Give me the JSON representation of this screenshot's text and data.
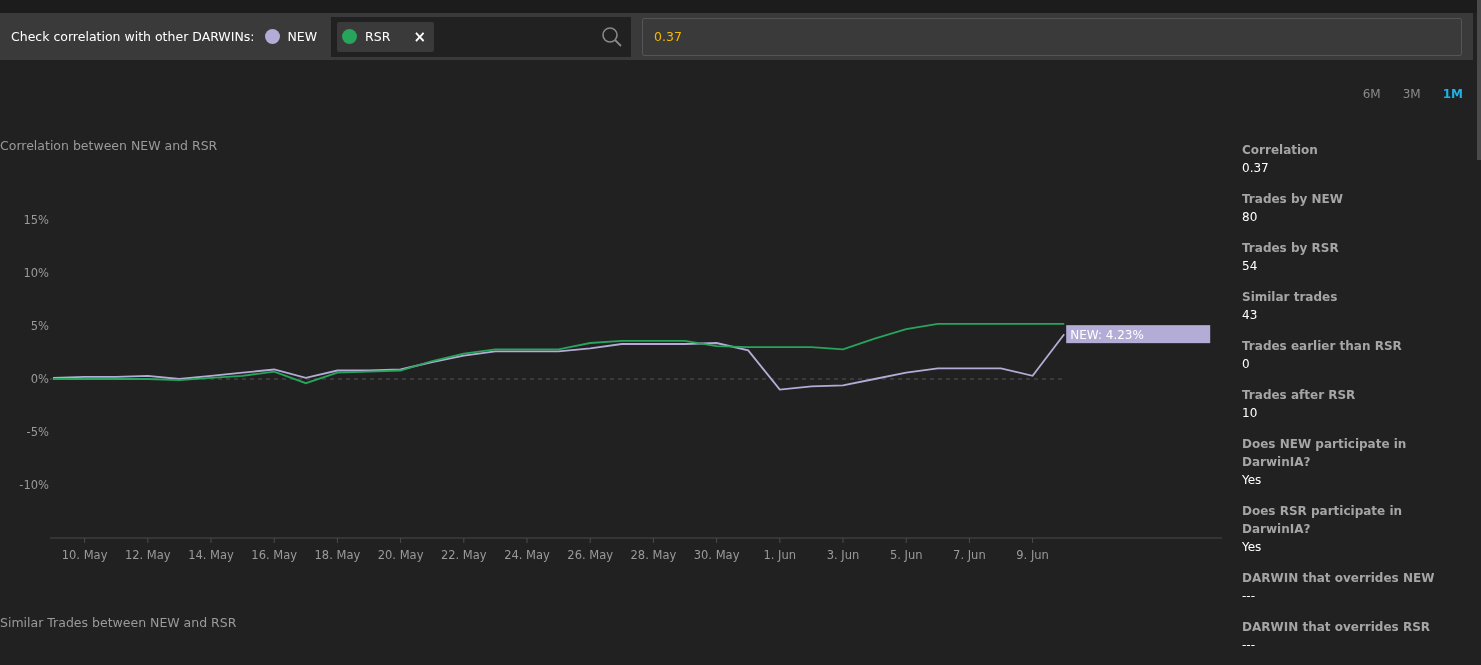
{
  "header": {
    "label": "Check correlation with other DARWINs:",
    "base": {
      "name": "NEW",
      "color": "#b3acd6"
    },
    "chips": [
      {
        "name": "RSR",
        "color": "#27a55a",
        "remove": "×"
      }
    ],
    "result": "0.37"
  },
  "ranges": [
    {
      "label": "6M",
      "selected": false
    },
    {
      "label": "3M",
      "selected": false
    },
    {
      "label": "1M",
      "selected": true
    }
  ],
  "chart": {
    "title": "Correlation between NEW and RSR",
    "chart_data": {
      "type": "line",
      "categories": [
        null,
        "10. May",
        null,
        "12. May",
        null,
        "14. May",
        null,
        "16. May",
        null,
        "18. May",
        null,
        "20. May",
        null,
        "22. May",
        null,
        "24. May",
        null,
        "26. May",
        null,
        "28. May",
        null,
        "30. May",
        null,
        "1. Jun",
        null,
        "3. Jun",
        null,
        "5. Jun",
        null,
        "7. Jun",
        null,
        "9. Jun",
        null
      ],
      "series": [
        {
          "color": "#b3acd6",
          "values": [
            0.1,
            0.2,
            0.2,
            0.3,
            0.0,
            0.3,
            0.6,
            0.9,
            0.1,
            0.8,
            0.8,
            0.9,
            1.6,
            2.2,
            2.6,
            2.6,
            2.6,
            2.9,
            3.3,
            3.3,
            3.3,
            3.4,
            2.7,
            -1.0,
            -0.7,
            -0.6,
            0.0,
            0.6,
            1.0,
            1.0,
            1.0,
            0.3,
            4.23
          ]
        },
        {
          "color": "#27a55a",
          "values": [
            0.0,
            0.0,
            0.0,
            0.0,
            -0.1,
            0.1,
            0.3,
            0.7,
            -0.4,
            0.6,
            0.7,
            0.8,
            1.7,
            2.4,
            2.8,
            2.8,
            2.8,
            3.4,
            3.6,
            3.6,
            3.6,
            3.1,
            3.0,
            3.0,
            3.0,
            2.8,
            3.8,
            4.7,
            5.2,
            5.2,
            5.2,
            5.2,
            5.2
          ]
        }
      ],
      "ylim": [
        -15,
        15
      ],
      "yticks": [
        {
          "value": 15,
          "label": "15%"
        },
        {
          "value": 10,
          "label": "10%"
        },
        {
          "value": 5,
          "label": "5%"
        },
        {
          "value": 0,
          "label": "0%"
        },
        {
          "value": -5,
          "label": "-5%"
        },
        {
          "value": -10,
          "label": "-10%"
        }
      ],
      "annotations": [
        "NEW: 4.23%"
      ]
    }
  },
  "stats": [
    {
      "label": "Correlation",
      "value": "0.37"
    },
    {
      "label": "Trades by NEW",
      "value": "80"
    },
    {
      "label": "Trades by RSR",
      "value": "54"
    },
    {
      "label": "Similar trades",
      "value": "43"
    },
    {
      "label": "Trades earlier than RSR",
      "value": "0"
    },
    {
      "label": "Trades after RSR",
      "value": "10"
    },
    {
      "label": "Does NEW participate in DarwinIA?",
      "value": "Yes"
    },
    {
      "label": "Does RSR participate in DarwinIA?",
      "value": "Yes"
    },
    {
      "label": "DARWIN that overrides NEW",
      "value": "---"
    },
    {
      "label": "DARWIN that overrides RSR",
      "value": "---"
    }
  ],
  "section_title": "Similar Trades between NEW and RSR"
}
